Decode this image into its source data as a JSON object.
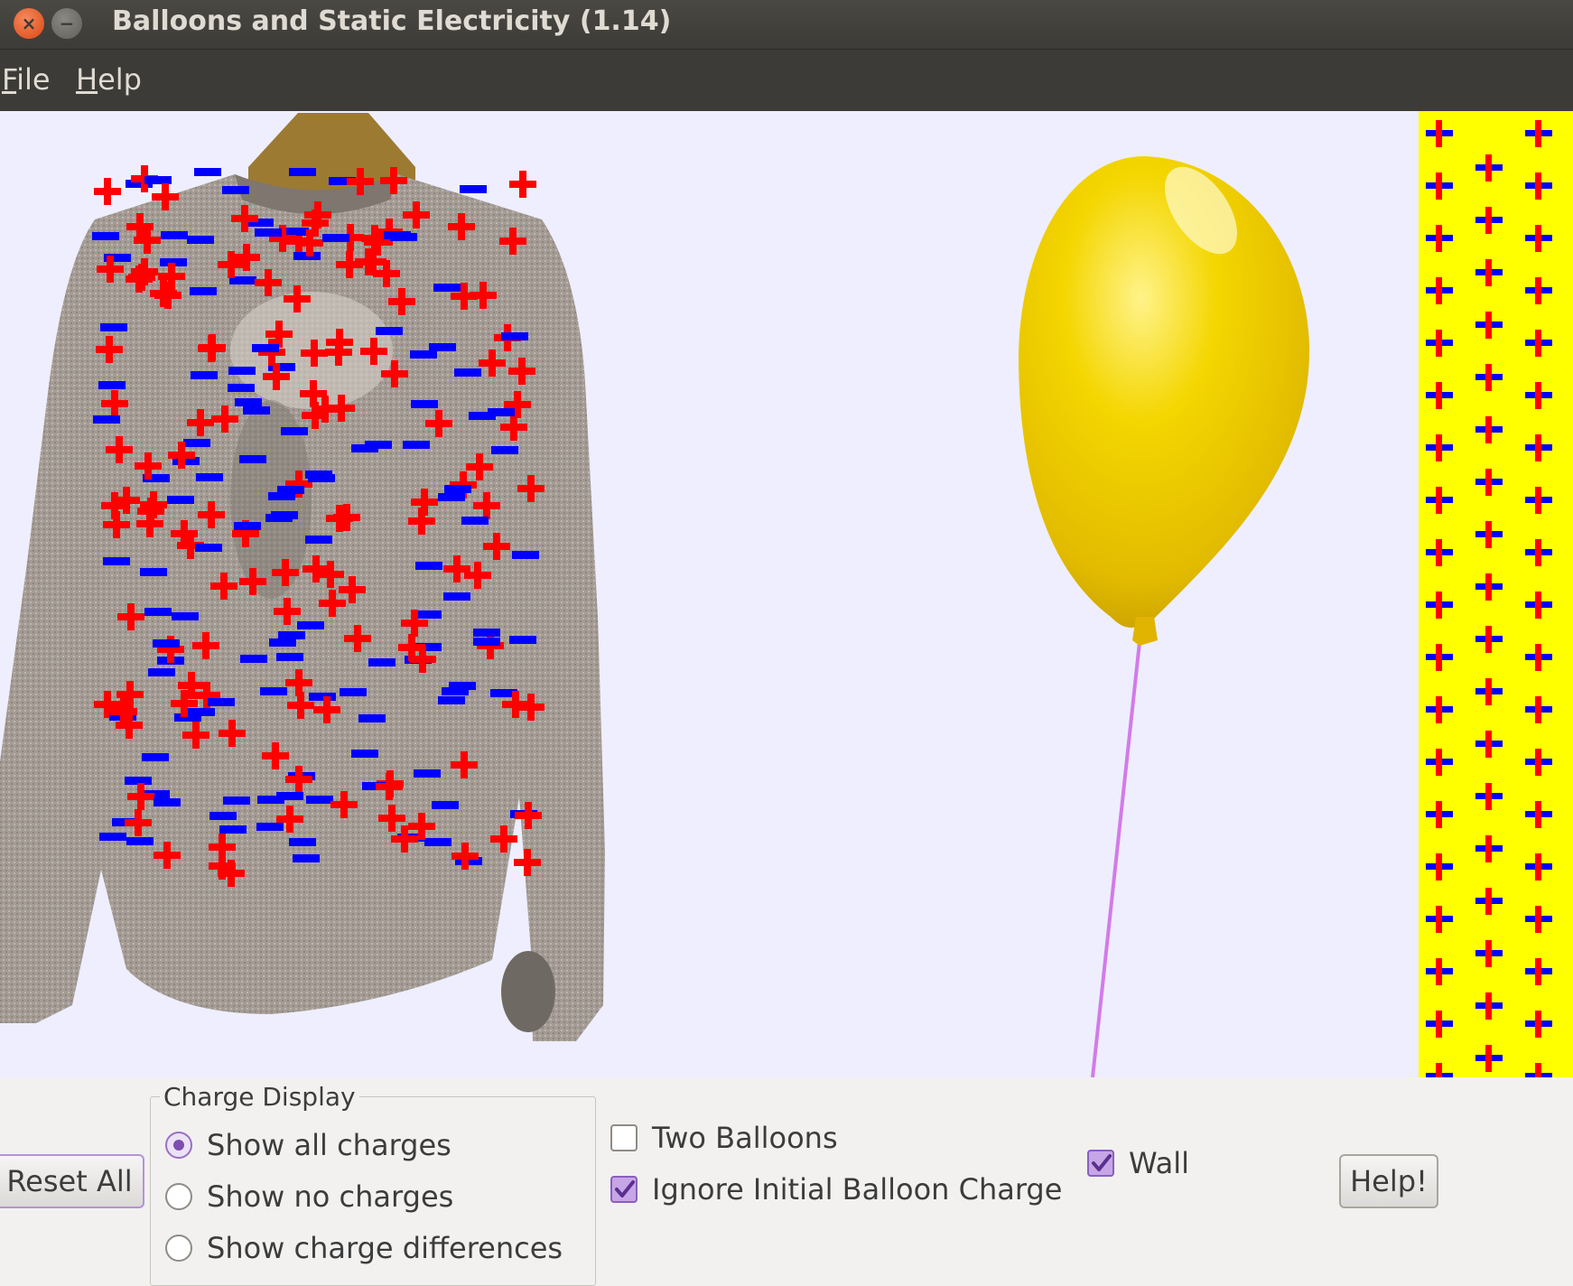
{
  "window": {
    "title": "Balloons and Static Electricity (1.14)"
  },
  "menu": {
    "file": {
      "mnemonic": "F",
      "rest": "ile"
    },
    "help": {
      "mnemonic": "H",
      "rest": "elp"
    }
  },
  "scene": {
    "sweater_icon": "sweater-icon",
    "balloon_icon": "yellow-balloon-icon",
    "wall_icon": "charged-wall-icon"
  },
  "controls": {
    "reset_label": "Reset All",
    "charge_display": {
      "legend": "Charge Display",
      "options": [
        {
          "label": "Show all charges",
          "selected": true
        },
        {
          "label": "Show no charges",
          "selected": false
        },
        {
          "label": "Show charge differences",
          "selected": false
        }
      ]
    },
    "two_balloons": {
      "label": "Two Balloons",
      "checked": false
    },
    "ignore_initial": {
      "label": "Ignore Initial Balloon Charge",
      "checked": true
    },
    "wall": {
      "label": "Wall",
      "checked": true
    },
    "help_label": "Help!"
  },
  "colors": {
    "positive_charge": "#ff0000",
    "negative_charge": "#0000ff",
    "wall": "#ffff00",
    "balloon": "#f2d000",
    "string": "#d27be8",
    "canvas_bg": "#eeeefe",
    "accent": "#8a5fbf"
  }
}
